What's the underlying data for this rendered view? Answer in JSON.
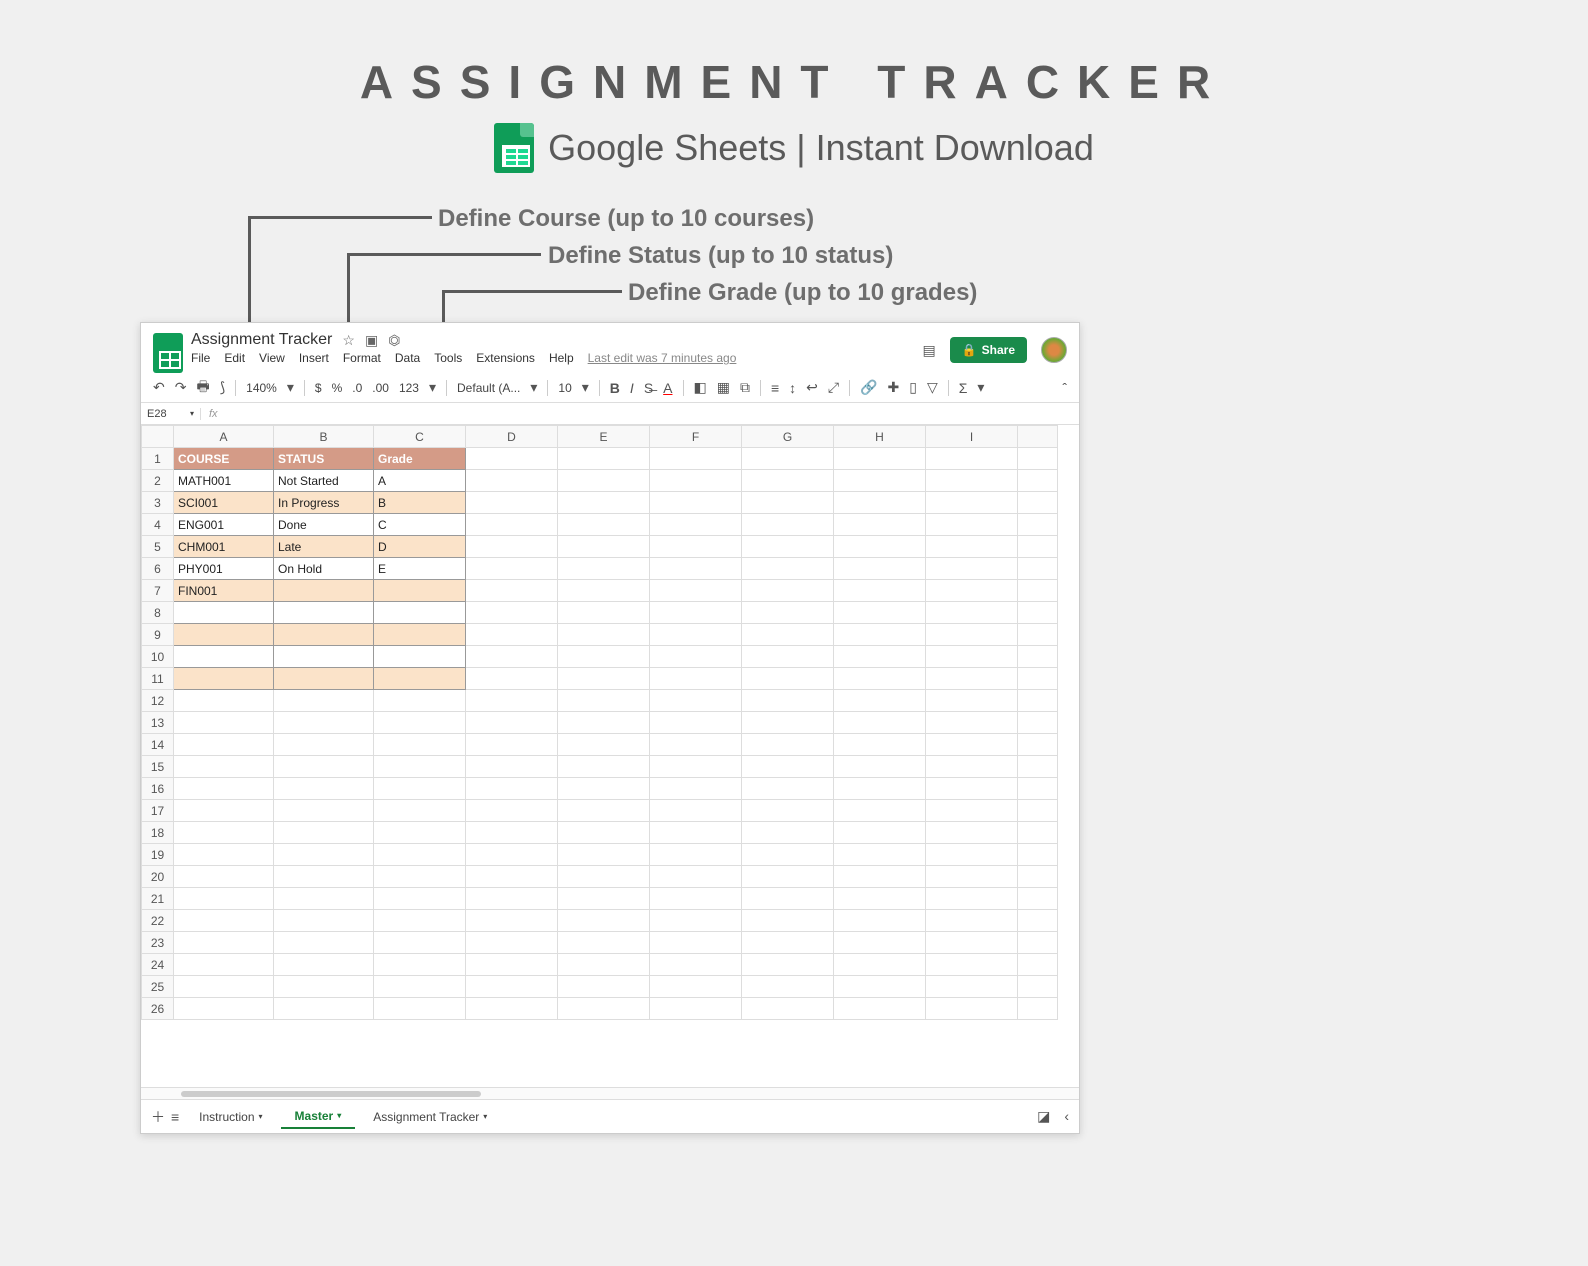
{
  "banner": {
    "title": "ASSIGNMENT TRACKER",
    "subtitle": "Google Sheets | Instant Download"
  },
  "callouts": {
    "course": "Define Course  (up to 10 courses)",
    "status": "Define Status  (up to 10 status)",
    "grade": "Define Grade (up to 10 grades)"
  },
  "app": {
    "doc_title": "Assignment Tracker",
    "last_edit": "Last edit was 7 minutes ago",
    "share": "Share",
    "menus": [
      "File",
      "Edit",
      "View",
      "Insert",
      "Format",
      "Data",
      "Tools",
      "Extensions",
      "Help"
    ],
    "toolbar": {
      "zoom": "140%",
      "currency": "$",
      "percent": "%",
      "dec0": ".0",
      "dec00": ".00",
      "numfmt": "123",
      "font": "Default (A...",
      "size": "10"
    },
    "namebox": "E28",
    "columns": [
      "A",
      "B",
      "C",
      "D",
      "E",
      "F",
      "G",
      "H",
      "I"
    ],
    "headers": {
      "A": "COURSE",
      "B": "STATUS",
      "C": "Grade"
    },
    "rows": [
      {
        "A": "MATH001",
        "B": "Not Started",
        "C": "A"
      },
      {
        "A": "SCI001",
        "B": "In Progress",
        "C": "B"
      },
      {
        "A": "ENG001",
        "B": "Done",
        "C": "C"
      },
      {
        "A": "CHM001",
        "B": "Late",
        "C": "D"
      },
      {
        "A": "PHY001",
        "B": "On Hold",
        "C": "E"
      },
      {
        "A": "FIN001",
        "B": "",
        "C": ""
      },
      {
        "A": "",
        "B": "",
        "C": ""
      },
      {
        "A": "",
        "B": "",
        "C": ""
      },
      {
        "A": "",
        "B": "",
        "C": ""
      },
      {
        "A": "",
        "B": "",
        "C": ""
      }
    ],
    "visible_rows": 26,
    "sheet_tabs": [
      {
        "label": "Instruction",
        "active": false
      },
      {
        "label": "Master",
        "active": true
      },
      {
        "label": "Assignment Tracker",
        "active": false
      }
    ]
  }
}
